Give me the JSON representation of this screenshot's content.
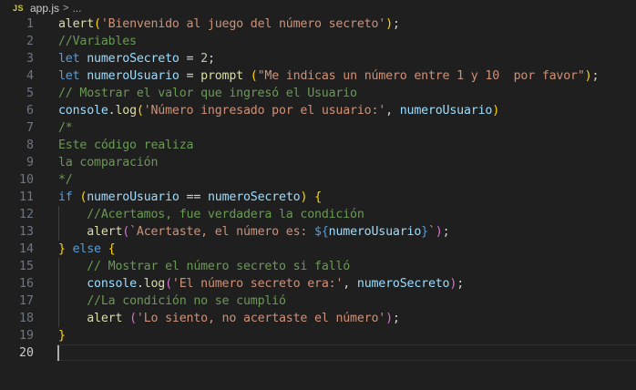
{
  "breadcrumb": {
    "language_badge": "JS",
    "file_name": "app.js",
    "separator": ">",
    "ellipsis": "..."
  },
  "editor": {
    "active_line": "20",
    "lines": [
      {
        "number": "1",
        "tokens": [
          {
            "t": "alert",
            "k": "fn"
          },
          {
            "t": "(",
            "k": "b1"
          },
          {
            "t": "'Bienvenido al juego del número secreto'",
            "k": "str"
          },
          {
            "t": ")",
            "k": "b1"
          },
          {
            "t": ";",
            "k": "plain"
          }
        ]
      },
      {
        "number": "2",
        "tokens": [
          {
            "t": "//Variables",
            "k": "com"
          }
        ]
      },
      {
        "number": "3",
        "tokens": [
          {
            "t": "let",
            "k": "kw"
          },
          {
            "t": " ",
            "k": "plain"
          },
          {
            "t": "numeroSecreto",
            "k": "var"
          },
          {
            "t": " = ",
            "k": "plain"
          },
          {
            "t": "2",
            "k": "num"
          },
          {
            "t": ";",
            "k": "plain"
          }
        ]
      },
      {
        "number": "4",
        "tokens": [
          {
            "t": "let",
            "k": "kw"
          },
          {
            "t": " ",
            "k": "plain"
          },
          {
            "t": "numeroUsuario",
            "k": "var"
          },
          {
            "t": " = ",
            "k": "plain"
          },
          {
            "t": "prompt",
            "k": "fn"
          },
          {
            "t": " ",
            "k": "plain"
          },
          {
            "t": "(",
            "k": "b1"
          },
          {
            "t": "\"Me indicas un número entre 1 y 10  por favor\"",
            "k": "str"
          },
          {
            "t": ")",
            "k": "b1"
          },
          {
            "t": ";",
            "k": "plain"
          }
        ]
      },
      {
        "number": "5",
        "tokens": [
          {
            "t": "// Mostrar el valor que ingresó el Usuario",
            "k": "com"
          }
        ]
      },
      {
        "number": "6",
        "tokens": [
          {
            "t": "console",
            "k": "var"
          },
          {
            "t": ".",
            "k": "plain"
          },
          {
            "t": "log",
            "k": "fn"
          },
          {
            "t": "(",
            "k": "b1"
          },
          {
            "t": "'Número ingresado por el usuario:'",
            "k": "str"
          },
          {
            "t": ", ",
            "k": "plain"
          },
          {
            "t": "numeroUsuario",
            "k": "var"
          },
          {
            "t": ")",
            "k": "b1"
          }
        ]
      },
      {
        "number": "7",
        "tokens": [
          {
            "t": "/*",
            "k": "com"
          }
        ]
      },
      {
        "number": "8",
        "tokens": [
          {
            "t": "Este código realiza",
            "k": "com"
          }
        ]
      },
      {
        "number": "9",
        "tokens": [
          {
            "t": "la comparación",
            "k": "com"
          }
        ]
      },
      {
        "number": "10",
        "tokens": [
          {
            "t": "*/",
            "k": "com"
          }
        ]
      },
      {
        "number": "11",
        "tokens": [
          {
            "t": "if",
            "k": "kw"
          },
          {
            "t": " ",
            "k": "plain"
          },
          {
            "t": "(",
            "k": "b1"
          },
          {
            "t": "numeroUsuario",
            "k": "var"
          },
          {
            "t": " == ",
            "k": "plain"
          },
          {
            "t": "numeroSecreto",
            "k": "var"
          },
          {
            "t": ")",
            "k": "b1"
          },
          {
            "t": " ",
            "k": "plain"
          },
          {
            "t": "{",
            "k": "b1"
          }
        ]
      },
      {
        "number": "12",
        "tokens": [
          {
            "t": "    ",
            "k": "plain"
          },
          {
            "t": "//Acertamos, fue verdadera la condición",
            "k": "com"
          }
        ]
      },
      {
        "number": "13",
        "tokens": [
          {
            "t": "    ",
            "k": "plain"
          },
          {
            "t": "alert",
            "k": "fn"
          },
          {
            "t": "(",
            "k": "b2"
          },
          {
            "t": "`Acertaste, el número es: ",
            "k": "str"
          },
          {
            "t": "${",
            "k": "kw"
          },
          {
            "t": "numeroUsuario",
            "k": "var"
          },
          {
            "t": "}",
            "k": "kw"
          },
          {
            "t": "`",
            "k": "str"
          },
          {
            "t": ")",
            "k": "b2"
          },
          {
            "t": ";",
            "k": "plain"
          }
        ]
      },
      {
        "number": "14",
        "tokens": [
          {
            "t": "}",
            "k": "b1"
          },
          {
            "t": " ",
            "k": "plain"
          },
          {
            "t": "else",
            "k": "kw"
          },
          {
            "t": " ",
            "k": "plain"
          },
          {
            "t": "{",
            "k": "b1"
          }
        ]
      },
      {
        "number": "15",
        "tokens": [
          {
            "t": "    ",
            "k": "plain"
          },
          {
            "t": "// Mostrar el número secreto si falló",
            "k": "com"
          }
        ]
      },
      {
        "number": "16",
        "tokens": [
          {
            "t": "    ",
            "k": "plain"
          },
          {
            "t": "console",
            "k": "var"
          },
          {
            "t": ".",
            "k": "plain"
          },
          {
            "t": "log",
            "k": "fn"
          },
          {
            "t": "(",
            "k": "b2"
          },
          {
            "t": "'El número secreto era:'",
            "k": "str"
          },
          {
            "t": ", ",
            "k": "plain"
          },
          {
            "t": "numeroSecreto",
            "k": "var"
          },
          {
            "t": ")",
            "k": "b2"
          },
          {
            "t": ";",
            "k": "plain"
          }
        ]
      },
      {
        "number": "17",
        "tokens": [
          {
            "t": "    ",
            "k": "plain"
          },
          {
            "t": "//La condición no se cumplió",
            "k": "com"
          }
        ]
      },
      {
        "number": "18",
        "tokens": [
          {
            "t": "    ",
            "k": "plain"
          },
          {
            "t": "alert",
            "k": "fn"
          },
          {
            "t": " ",
            "k": "plain"
          },
          {
            "t": "(",
            "k": "b2"
          },
          {
            "t": "'Lo siento, no acertaste el número'",
            "k": "str"
          },
          {
            "t": ")",
            "k": "b2"
          },
          {
            "t": ";",
            "k": "plain"
          }
        ]
      },
      {
        "number": "19",
        "tokens": [
          {
            "t": "}",
            "k": "b1"
          }
        ]
      },
      {
        "number": "20",
        "tokens": []
      }
    ]
  },
  "colors": {
    "background": "#1f1f1f",
    "function": "#dcdcaa",
    "string": "#ce9178",
    "keyword": "#569cd6",
    "variable": "#9cdcfe",
    "number": "#b5cea8",
    "comment": "#6a9955",
    "bracket_level_1": "#ffd700",
    "bracket_level_2": "#da70d6"
  }
}
